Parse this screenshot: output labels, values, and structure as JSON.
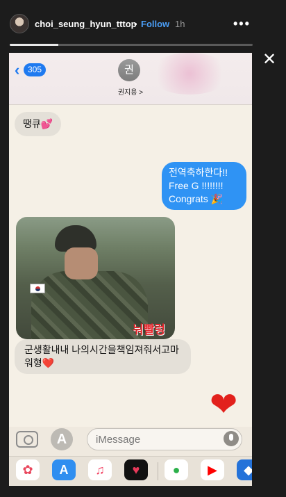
{
  "story": {
    "username": "choi_seung_hyun_tttop",
    "separator": "•",
    "follow_label": "Follow",
    "time": "1h",
    "more_label": "•••",
    "close_label": "✕",
    "progress": 0.2
  },
  "messages_screen": {
    "back_badge": "305",
    "contact_initial": "권",
    "contact_name": "권지용 >",
    "incoming_1": "땡큐💕",
    "outgoing_1": "전역축하한다!!\nFree G !!!!!!!!\nCongrats 🎉",
    "photo_caption": "눠빨렁",
    "incoming_2": "군생활내내 나의시간을책임져줘서고마워형❤️",
    "big_heart": "❤",
    "input_placeholder": "iMessage"
  },
  "app_drawer": {
    "icons": [
      "photos-icon",
      "appstore-icon",
      "music-icon",
      "heart-app-icon",
      "green-app-icon",
      "youtube-icon",
      "dropbox-icon"
    ]
  },
  "colors": {
    "imessage_blue": "#2f93f4",
    "follow_blue": "#4b9ef6",
    "heart_red": "#e2211c"
  }
}
